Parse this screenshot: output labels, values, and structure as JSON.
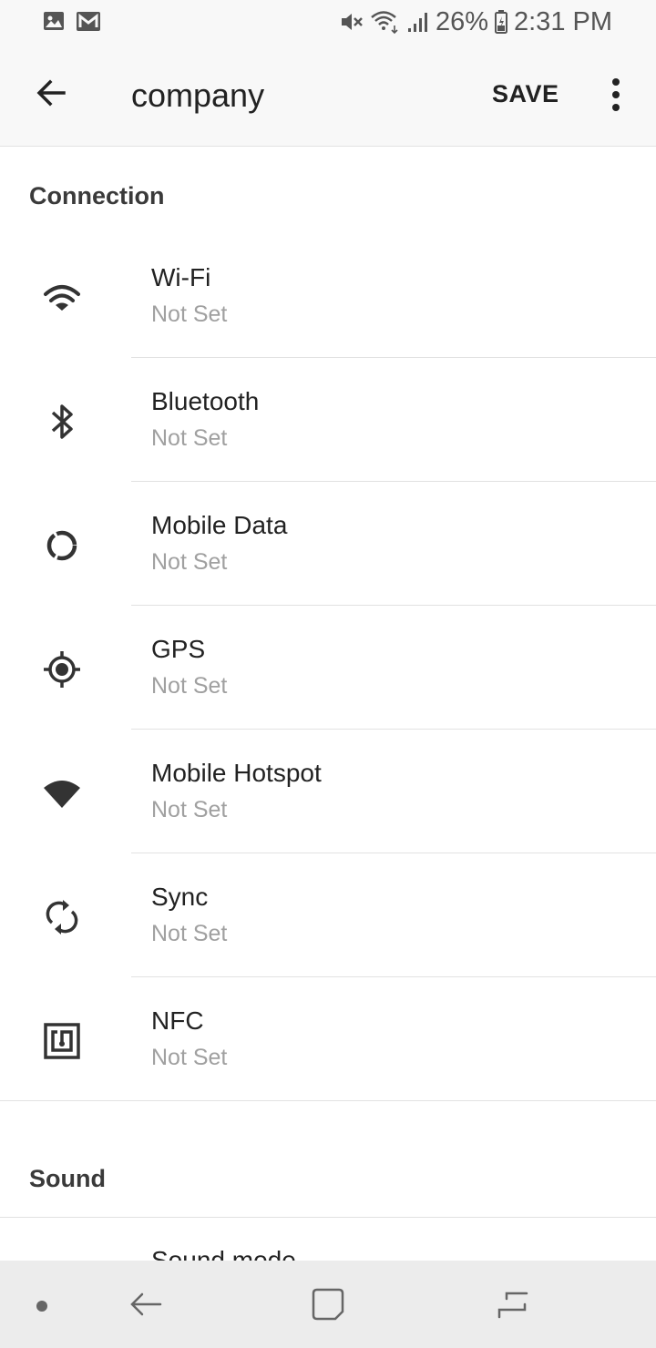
{
  "status_bar": {
    "battery": "26%",
    "time": "2:31 PM",
    "icons": [
      "gallery-icon",
      "gmail-icon",
      "mute-icon",
      "wifi-icon",
      "signal-icon",
      "battery-icon"
    ]
  },
  "app_bar": {
    "title": "company",
    "save_label": "SAVE",
    "back_icon": "back-arrow-icon",
    "more_icon": "more-vert-icon"
  },
  "sections": [
    {
      "header": "Connection",
      "items": [
        {
          "title": "Wi-Fi",
          "value": "Not Set",
          "icon": "wifi-icon"
        },
        {
          "title": "Bluetooth",
          "value": "Not Set",
          "icon": "bluetooth-icon"
        },
        {
          "title": "Mobile Data",
          "value": "Not Set",
          "icon": "mobile-data-icon"
        },
        {
          "title": "GPS",
          "value": "Not Set",
          "icon": "gps-icon"
        },
        {
          "title": "Mobile Hotspot",
          "value": "Not Set",
          "icon": "hotspot-icon"
        },
        {
          "title": "Sync",
          "value": "Not Set",
          "icon": "sync-icon"
        },
        {
          "title": "NFC",
          "value": "Not Set",
          "icon": "nfc-icon"
        }
      ]
    },
    {
      "header": "Sound",
      "items": [
        {
          "title": "Sound mode"
        }
      ]
    }
  ],
  "nav_bar": {
    "icons": [
      "dot-icon",
      "back-icon",
      "home-icon",
      "recents-icon"
    ]
  },
  "colors": {
    "background": "#ffffff",
    "bar_background": "#f8f8f8",
    "nav_background": "#ececec",
    "primary_text": "#222222",
    "secondary_text": "#a0a0a0",
    "divider": "#e2e2e2"
  }
}
